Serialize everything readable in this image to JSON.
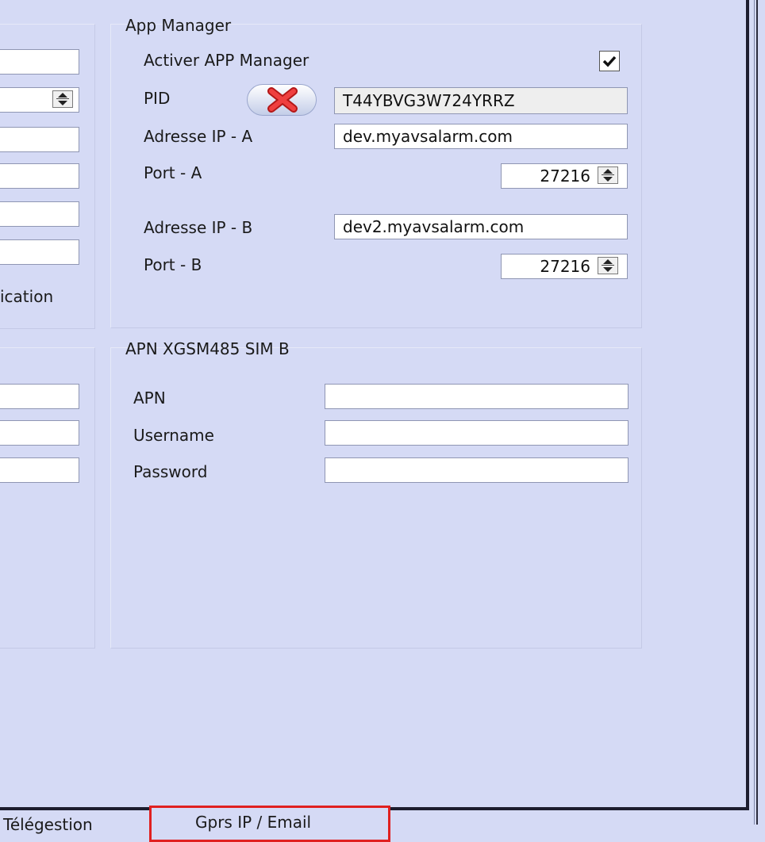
{
  "left_panel": {
    "fields": [
      "",
      "",
      "",
      "",
      ""
    ],
    "partial_label": "ication",
    "apn_fields": [
      "",
      "",
      ""
    ]
  },
  "app_manager": {
    "title": "App Manager",
    "enable_label": "Activer APP Manager",
    "enable_checked": true,
    "pid_label": "PID",
    "pid_value": "T44YBVG3W724YRRZ",
    "ip_a_label": "Adresse IP - A",
    "ip_a_value": "dev.myavsalarm.com",
    "port_a_label": "Port - A",
    "port_a_value": "27216",
    "ip_b_label": "Adresse IP - B",
    "ip_b_value": "dev2.myavsalarm.com",
    "port_b_label": "Port - B",
    "port_b_value": "27216"
  },
  "apn_sim_b": {
    "title": "APN XGSM485 SIM B",
    "apn_label": "APN",
    "apn_value": "",
    "username_label": "Username",
    "username_value": "",
    "password_label": "Password",
    "password_value": ""
  },
  "tabs": {
    "telegestion": "Télégestion",
    "gprs": "Gprs IP / Email"
  },
  "colors": {
    "background": "#d5daf5",
    "highlight": "#e02020"
  }
}
